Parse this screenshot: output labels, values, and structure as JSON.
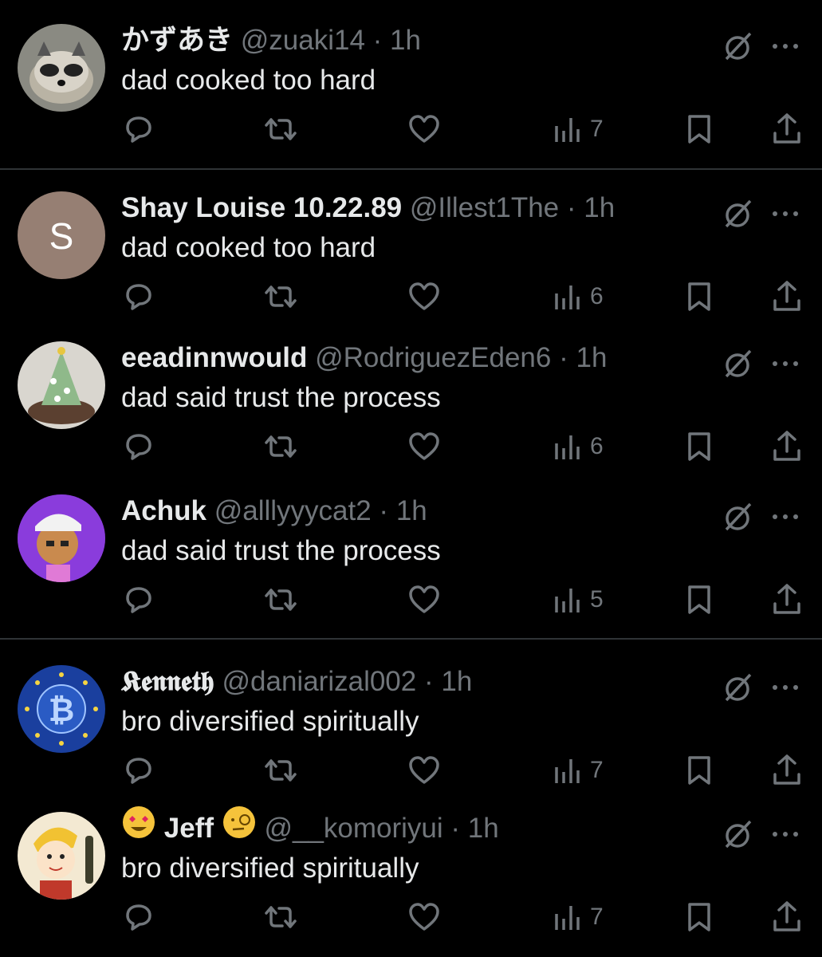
{
  "replies": [
    {
      "name": "かずあき",
      "handle": "@zuaki14",
      "sep": "·",
      "time": "1h",
      "text": "dad cooked too hard",
      "views": "7",
      "avatar": "raccoon"
    },
    {
      "name": "Shay Louise 10.22.89",
      "handle": "@Illest1The",
      "sep": "·",
      "time": "1h",
      "text": "dad cooked too hard",
      "views": "6",
      "avatar": "letter-s",
      "avatar_letter": "S"
    },
    {
      "name": "eeadinnwould",
      "handle": "@RodriguezEden6",
      "sep": "·",
      "time": "1h",
      "text": "dad said trust the process",
      "views": "6",
      "avatar": "cake-tree"
    },
    {
      "name": "Achuk",
      "handle": "@alllyyycat2",
      "sep": "·",
      "time": "1h",
      "text": "dad said trust the process",
      "views": "5",
      "avatar": "cartoon-purple"
    },
    {
      "name": "𝕶𝖊𝖓𝖓𝖊𝖙𝖍",
      "handle": "@daniarizal002",
      "sep": "·",
      "time": "1h",
      "text": "bro diversified spiritually",
      "views": "7",
      "avatar": "bitcoin"
    },
    {
      "name": "Jeff",
      "handle": "@__komoriyui",
      "sep": "·",
      "time": "1h",
      "text": "bro diversified spiritually",
      "views": "7",
      "avatar": "cartoon-boy"
    }
  ],
  "colors": {
    "background": "#000000",
    "text": "#e7e9ea",
    "muted": "#71767b",
    "divider": "#2f3336"
  },
  "icons": [
    "grok-icon",
    "more-icon",
    "reply-icon",
    "retweet-icon",
    "like-icon",
    "views-icon",
    "bookmark-icon",
    "share-icon"
  ]
}
